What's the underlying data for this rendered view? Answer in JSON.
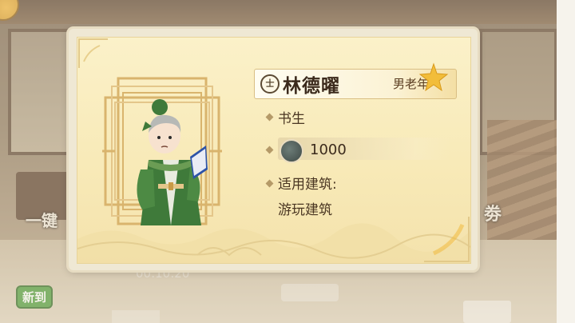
{
  "background": {
    "left_button_label": "一键",
    "right_button_label": "劵",
    "new_badge_label": "新到",
    "timer_text": "00:10:20"
  },
  "character": {
    "rank_icon": "士",
    "name": "林德曜",
    "tag": "男老年",
    "title": "书生",
    "coin_value": "1000",
    "building_label": "适用建筑:",
    "building_value": "游玩建筑"
  },
  "colors": {
    "card_bg": "#f8eab8",
    "frame_gold": "#d9b46d",
    "text_dark": "#3b2a1c",
    "robe_green": "#3f7a3a"
  },
  "icons": {
    "rank": "seal-icon",
    "coin": "jade-coin-icon",
    "star": "sparkle-star-icon"
  }
}
